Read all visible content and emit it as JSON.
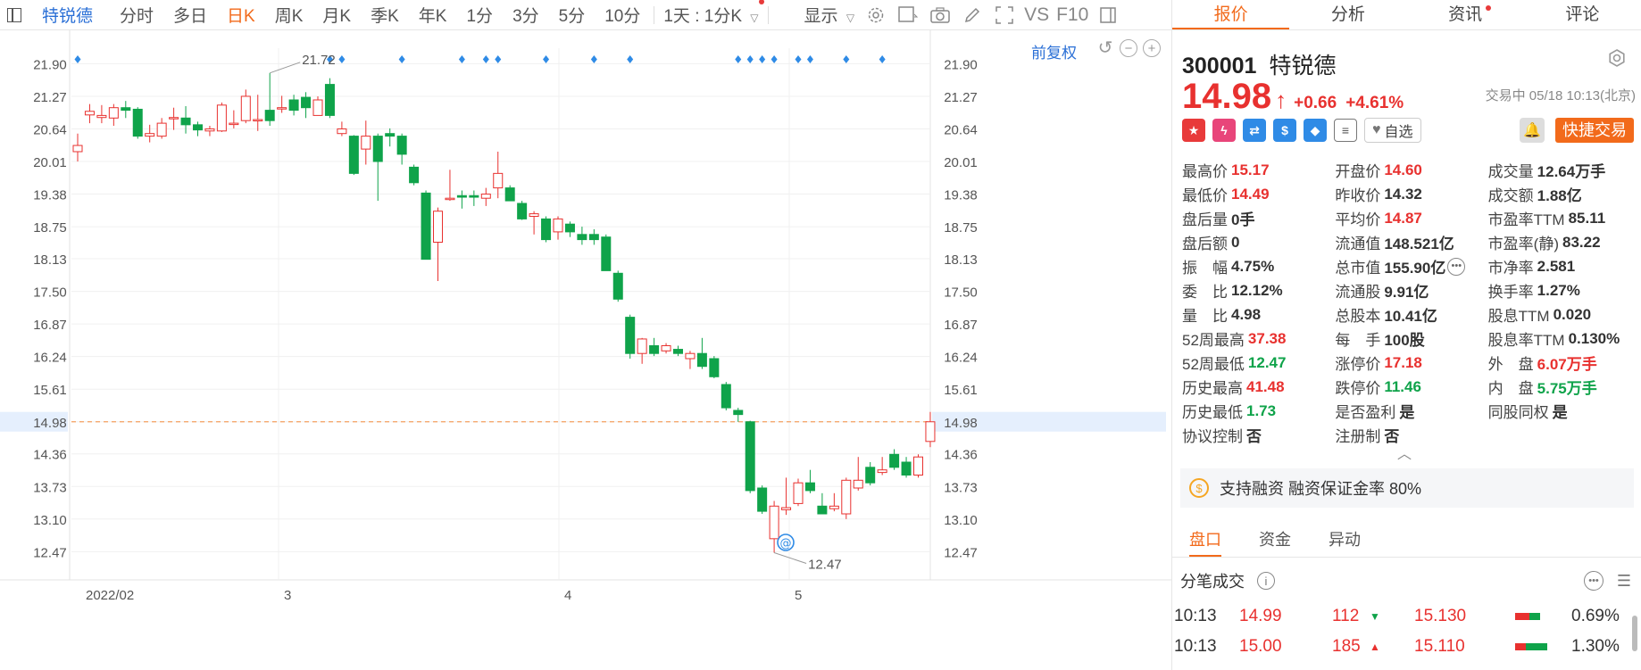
{
  "toolbar": {
    "stock_name": "特锐德",
    "periods": [
      "分时",
      "多日",
      "日K",
      "周K",
      "月K",
      "季K",
      "年K",
      "1分",
      "3分",
      "5分",
      "10分"
    ],
    "active_period": "日K",
    "multi_frame": "1天 : 1分K",
    "display": "显示",
    "compare": "VS",
    "f10": "F10"
  },
  "chart": {
    "fuquan": "前复权",
    "price_ticks": [
      "21.90",
      "21.27",
      "20.64",
      "20.01",
      "19.38",
      "18.75",
      "18.13",
      "17.50",
      "16.87",
      "16.24",
      "15.61",
      "14.98",
      "14.36",
      "13.73",
      "13.10",
      "12.47"
    ],
    "current_price_tick": "14.98",
    "date_labels": [
      "2022/02",
      "3",
      "4",
      "5"
    ],
    "high_label": "21.72",
    "low_label": "12.47"
  },
  "chart_data": {
    "type": "candlestick",
    "ylim": [
      12.2,
      22.2
    ],
    "candles": [
      [
        20.2,
        20.32,
        20.01,
        20.55
      ],
      [
        20.91,
        20.98,
        20.75,
        21.12
      ],
      [
        20.86,
        20.9,
        20.75,
        21.1
      ],
      [
        20.85,
        21.05,
        20.7,
        21.12
      ],
      [
        21.05,
        21.0,
        20.85,
        21.18
      ],
      [
        21.02,
        20.5,
        20.45,
        21.06
      ],
      [
        20.5,
        20.55,
        20.38,
        20.72
      ],
      [
        20.5,
        20.75,
        20.45,
        20.85
      ],
      [
        20.86,
        20.86,
        20.62,
        21.05
      ],
      [
        20.85,
        20.72,
        20.55,
        21.08
      ],
      [
        20.72,
        20.62,
        20.5,
        20.78
      ],
      [
        20.6,
        20.64,
        20.5,
        20.7
      ],
      [
        20.6,
        21.1,
        20.58,
        21.15
      ],
      [
        20.75,
        20.75,
        20.65,
        21.0
      ],
      [
        20.8,
        21.27,
        20.75,
        21.4
      ],
      [
        20.82,
        20.82,
        20.6,
        21.3
      ],
      [
        21.0,
        20.8,
        20.7,
        21.72
      ],
      [
        21.05,
        21.05,
        20.95,
        21.28
      ],
      [
        21.2,
        21.0,
        20.9,
        21.3
      ],
      [
        21.25,
        21.05,
        20.85,
        21.35
      ],
      [
        20.9,
        21.2,
        20.9,
        21.27
      ],
      [
        21.5,
        20.9,
        20.85,
        21.62
      ],
      [
        20.55,
        20.64,
        20.5,
        20.78
      ],
      [
        20.5,
        19.78,
        19.75,
        20.52
      ],
      [
        20.25,
        20.5,
        19.95,
        20.8
      ],
      [
        20.5,
        20.01,
        19.25,
        20.55
      ],
      [
        20.55,
        20.5,
        20.3,
        20.65
      ],
      [
        20.5,
        20.15,
        19.95,
        20.55
      ],
      [
        19.9,
        19.6,
        19.55,
        19.95
      ],
      [
        19.4,
        18.12,
        18.12,
        19.45
      ],
      [
        18.45,
        19.05,
        17.7,
        19.12
      ],
      [
        19.3,
        19.3,
        19.25,
        19.85
      ],
      [
        19.35,
        19.32,
        19.1,
        19.45
      ],
      [
        19.35,
        19.32,
        19.15,
        19.45
      ],
      [
        19.3,
        19.38,
        19.15,
        19.5
      ],
      [
        19.5,
        19.78,
        19.3,
        20.2
      ],
      [
        19.5,
        19.25,
        19.25,
        19.55
      ],
      [
        19.2,
        18.9,
        18.88,
        19.25
      ],
      [
        18.95,
        19.0,
        18.6,
        19.05
      ],
      [
        18.9,
        18.5,
        18.45,
        18.95
      ],
      [
        18.65,
        18.9,
        18.5,
        18.95
      ],
      [
        18.8,
        18.65,
        18.55,
        18.85
      ],
      [
        18.6,
        18.5,
        18.4,
        18.75
      ],
      [
        18.6,
        18.5,
        18.4,
        18.7
      ],
      [
        18.55,
        17.9,
        17.9,
        18.6
      ],
      [
        17.85,
        17.35,
        17.3,
        17.9
      ],
      [
        17.0,
        16.3,
        16.2,
        17.05
      ],
      [
        16.3,
        16.58,
        16.1,
        16.6
      ],
      [
        16.45,
        16.3,
        16.25,
        16.6
      ],
      [
        16.35,
        16.45,
        16.3,
        16.5
      ],
      [
        16.38,
        16.3,
        16.25,
        16.45
      ],
      [
        16.2,
        16.3,
        16.0,
        16.35
      ],
      [
        16.3,
        16.05,
        16.0,
        16.6
      ],
      [
        16.2,
        15.85,
        15.82,
        16.25
      ],
      [
        15.7,
        15.25,
        15.2,
        15.75
      ],
      [
        15.2,
        15.12,
        14.98,
        15.25
      ],
      [
        14.98,
        13.65,
        13.6,
        15.0
      ],
      [
        13.7,
        13.25,
        13.2,
        13.75
      ],
      [
        12.72,
        13.35,
        12.45,
        13.45
      ],
      [
        13.28,
        13.32,
        13.18,
        13.9
      ],
      [
        13.4,
        13.8,
        13.35,
        13.88
      ],
      [
        13.8,
        13.65,
        13.6,
        14.05
      ],
      [
        13.35,
        13.2,
        13.2,
        13.6
      ],
      [
        13.3,
        13.35,
        13.25,
        13.6
      ],
      [
        13.2,
        13.85,
        13.1,
        13.9
      ],
      [
        13.7,
        13.85,
        13.65,
        14.3
      ],
      [
        14.1,
        13.8,
        13.75,
        14.2
      ],
      [
        14.0,
        14.05,
        13.95,
        14.3
      ],
      [
        14.35,
        14.1,
        14.05,
        14.45
      ],
      [
        14.2,
        13.95,
        13.9,
        14.3
      ],
      [
        13.95,
        14.3,
        13.9,
        14.35
      ],
      [
        14.6,
        14.98,
        14.49,
        15.17
      ]
    ],
    "event_markers": [
      0,
      21,
      22,
      27,
      32,
      34,
      35,
      39,
      43,
      46,
      55,
      56,
      57,
      58,
      60,
      61,
      64,
      67
    ]
  },
  "quote": {
    "tabs": [
      "报价",
      "分析",
      "资讯",
      "评论"
    ],
    "code": "300001",
    "name": "特锐德",
    "price": "14.98",
    "change": "+0.66",
    "pct": "+4.61%",
    "status": "交易中 05/18 10:13(北京)",
    "watch": "自选",
    "trade": "快捷交易"
  },
  "stats": [
    [
      [
        "最高价",
        "15.17",
        "red"
      ],
      [
        "开盘价",
        "14.60",
        "red"
      ],
      [
        "成交量",
        "12.64万手",
        "dark"
      ]
    ],
    [
      [
        "最低价",
        "14.49",
        "red"
      ],
      [
        "昨收价",
        "14.32",
        "dark"
      ],
      [
        "成交额",
        "1.88亿",
        "dark"
      ]
    ],
    [
      [
        "盘后量",
        "0手",
        "dark"
      ],
      [
        "平均价",
        "14.87",
        "red"
      ],
      [
        "市盈率TTM",
        "85.11",
        "dark"
      ]
    ],
    [
      [
        "盘后额",
        "0",
        "dark"
      ],
      [
        "流通值",
        "148.521亿",
        "dark"
      ],
      [
        "市盈率(静)",
        "83.22",
        "dark"
      ]
    ],
    [
      [
        "振　幅",
        "4.75%",
        "dark"
      ],
      [
        "总市值",
        "155.90亿",
        "dark"
      ],
      [
        "市净率",
        "2.581",
        "dark"
      ]
    ],
    [
      [
        "委　比",
        "12.12%",
        "dark"
      ],
      [
        "流通股",
        "9.91亿",
        "dark"
      ],
      [
        "换手率",
        "1.27%",
        "dark"
      ]
    ],
    [
      [
        "量　比",
        "4.98",
        "dark"
      ],
      [
        "总股本",
        "10.41亿",
        "dark"
      ],
      [
        "股息TTM",
        "0.020",
        "dark"
      ]
    ],
    [
      [
        "52周最高",
        "37.38",
        "red"
      ],
      [
        "每　手",
        "100股",
        "dark"
      ],
      [
        "股息率TTM",
        "0.130%",
        "dark"
      ]
    ],
    [
      [
        "52周最低",
        "12.47",
        "green"
      ],
      [
        "涨停价",
        "17.18",
        "red"
      ],
      [
        "外　盘",
        "6.07万手",
        "red"
      ]
    ],
    [
      [
        "历史最高",
        "41.48",
        "red"
      ],
      [
        "跌停价",
        "11.46",
        "green"
      ],
      [
        "内　盘",
        "5.75万手",
        "green"
      ]
    ],
    [
      [
        "历史最低",
        "1.73",
        "green"
      ],
      [
        "是否盈利",
        "是",
        "dark"
      ],
      [
        "同股同权",
        "是",
        "dark"
      ]
    ],
    [
      [
        "协议控制",
        "否",
        "dark"
      ],
      [
        "注册制",
        "否",
        "dark"
      ],
      [
        "",
        "",
        "dark"
      ]
    ]
  ],
  "margin": "支持融资 融资保证金率 80%",
  "panel_tabs": [
    "盘口",
    "资金",
    "异动"
  ],
  "trades_title": "分笔成交",
  "trades": [
    {
      "time": "10:13",
      "price": "14.99",
      "vol": "112",
      "dir": "dn",
      "bp": "15.130",
      "red": 0.4,
      "green": 0.3,
      "pct": "0.69%"
    },
    {
      "time": "10:13",
      "price": "15.00",
      "vol": "185",
      "dir": "up",
      "bp": "15.110",
      "red": 0.3,
      "green": 0.6,
      "pct": "1.30%"
    }
  ]
}
